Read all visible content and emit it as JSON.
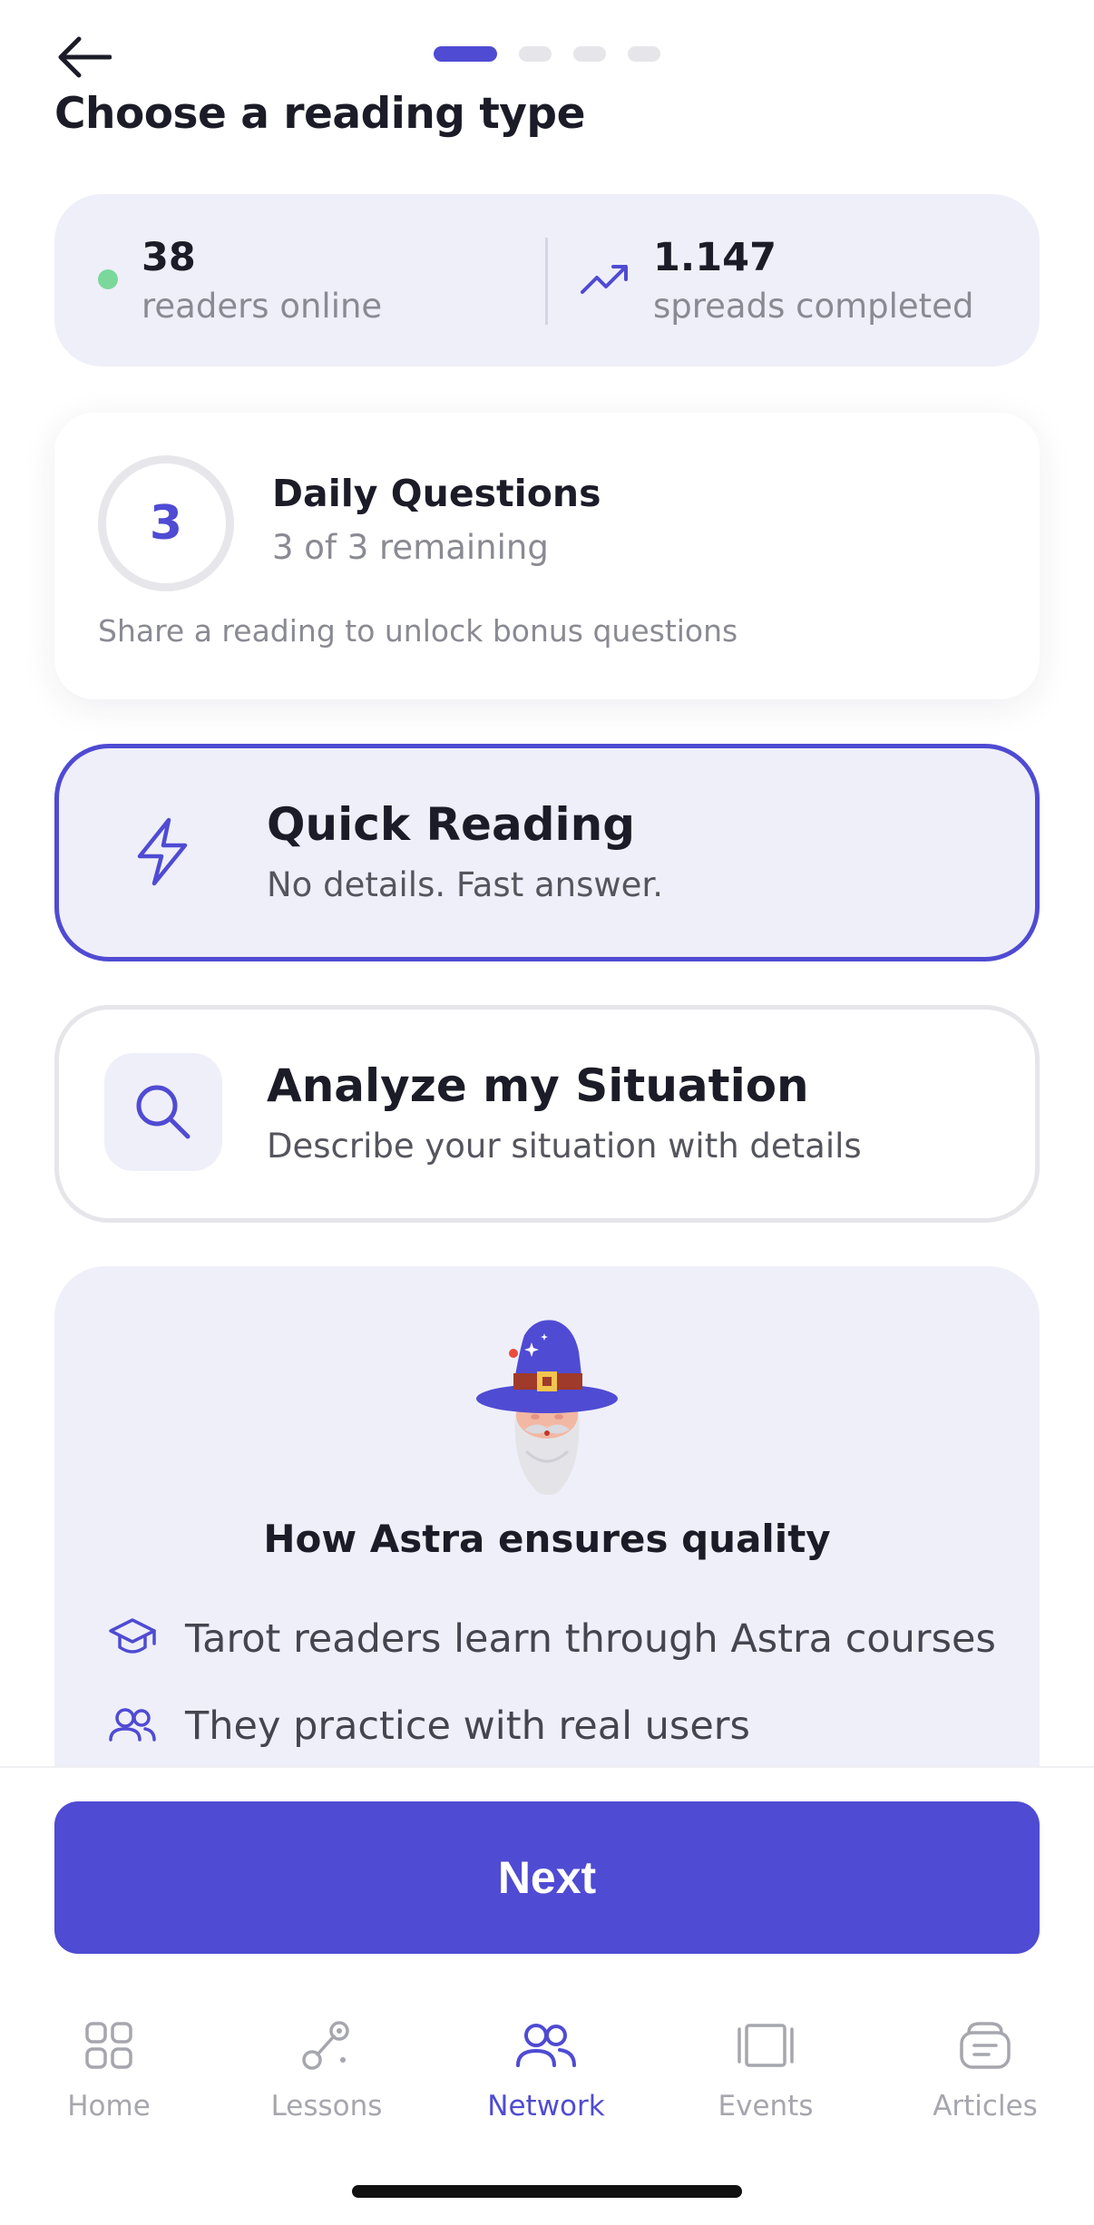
{
  "header": {
    "title": "Choose a reading type",
    "step_current": 1,
    "step_total": 4
  },
  "stats": {
    "readers_online": "38",
    "readers_label": "readers online",
    "spreads_completed": "1.147",
    "spreads_label": "spreads completed"
  },
  "daily": {
    "count": "3",
    "title": "Daily Questions",
    "subtitle": "3 of 3 remaining",
    "hint": "Share a reading to unlock bonus questions"
  },
  "options": {
    "quick": {
      "title": "Quick Reading",
      "subtitle": "No details. Fast answer.",
      "selected": true
    },
    "analyze": {
      "title": "Analyze my Situation",
      "subtitle": "Describe your situation with details",
      "selected": false
    }
  },
  "quality": {
    "title": "How Astra ensures quality",
    "items": [
      "Tarot readers learn through Astra courses",
      "They practice with real users"
    ]
  },
  "next_label": "Next",
  "nav": {
    "home": "Home",
    "lessons": "Lessons",
    "network": "Network",
    "events": "Events",
    "articles": "Articles",
    "active": "Network"
  },
  "colors": {
    "accent": "#4f4bd3",
    "card_bg": "#efeff9",
    "online": "#7bd89b",
    "muted": "#8a8a93"
  }
}
